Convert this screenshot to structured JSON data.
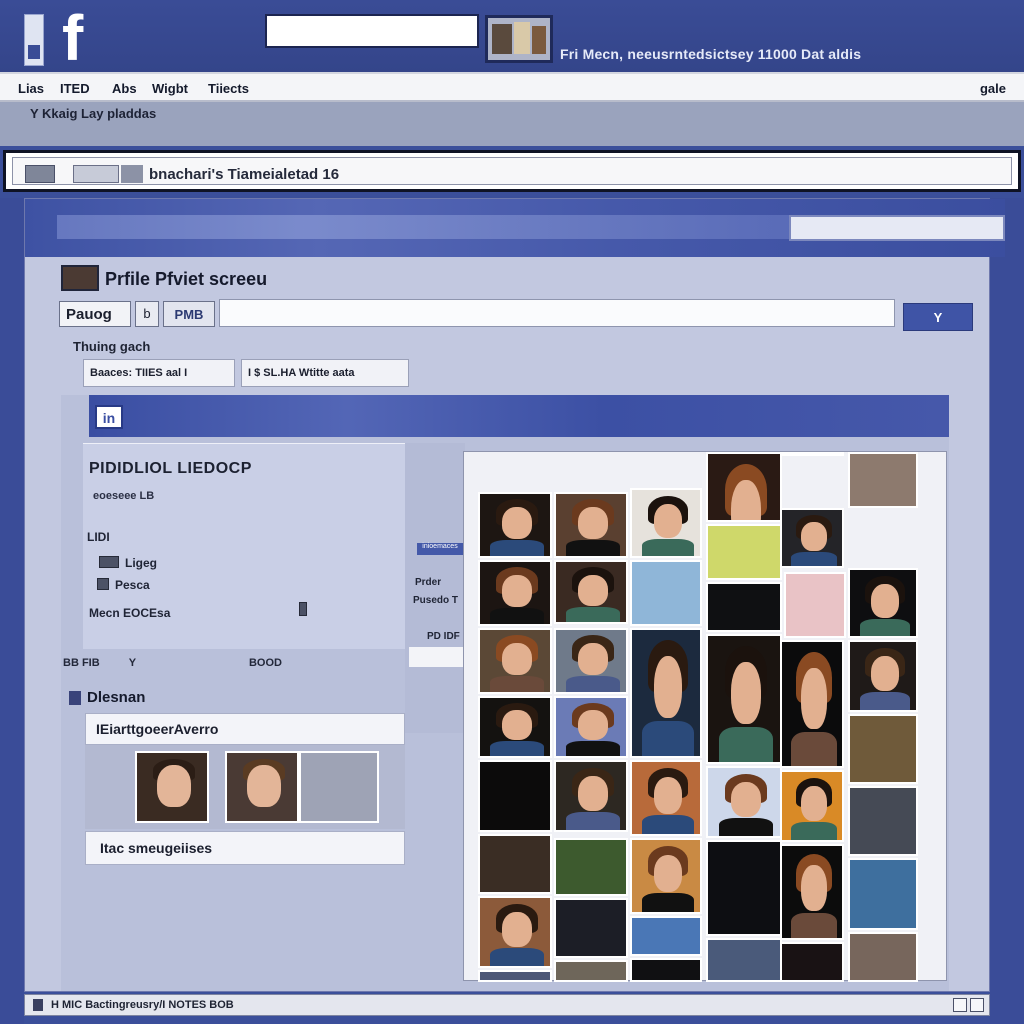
{
  "header": {
    "logo": "f",
    "status_text": "Fri Mecn, neeusrntedsictsey 11000 Dat aldis"
  },
  "nav": {
    "items": [
      "Lias",
      "ITED",
      "Abs",
      "Wigbt",
      "Tiiects"
    ],
    "right": "gale",
    "subtitle": "Y Kkaig Lay pladdas"
  },
  "address": {
    "text": "bnachari's Tiameialetad 16"
  },
  "profile": {
    "title": "Prfile Pfviet screeu",
    "tabs": [
      "Pauog",
      "b",
      "PMB"
    ],
    "go_button": "Y",
    "section_label": "Thuing gach",
    "pill_1": "Baaces: TIIES aal I",
    "pill_2": "I $ SL.HA Wtitte aata",
    "panel_icon": "in",
    "name": "PIDIDLIOL LIEDOCP",
    "sub": "eoeseee LB",
    "info_rows": [
      "LIDI",
      "Ligeg",
      "Pesca",
      "Mecn EOCEsa"
    ],
    "mid_badge": "inioemaces",
    "mid_text_1": "Prder",
    "mid_text_2": "Pusedo T",
    "mid_text_3": "PD IDF",
    "row_footer_left": "BB FIB",
    "row_footer_mid": "Y",
    "row_footer_right": "BOOD",
    "design_label": "Dlesnan",
    "design_card": "IEiarttgoeerAverro",
    "design_foot": "Itac smeugeiises"
  },
  "status_bar": {
    "text": "H MIC Bactingreusry/I NOTES BOB"
  },
  "colors": {
    "brand": "#3b4f9a",
    "panel": "#c2c8e0",
    "accent": "#3f54a6"
  }
}
